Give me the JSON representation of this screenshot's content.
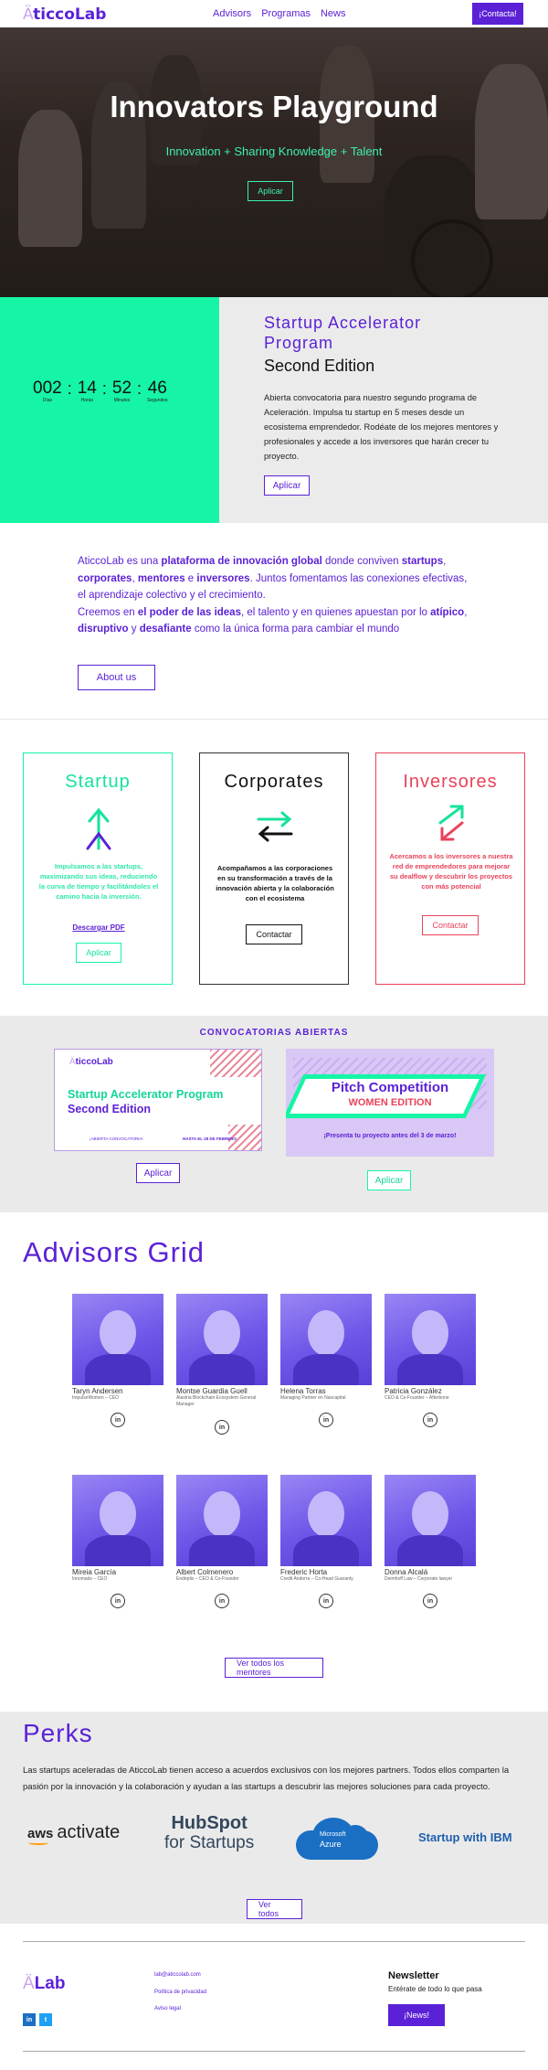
{
  "nav": {
    "logo_a": "Ä",
    "logo_rest": "ticcoLab",
    "links": [
      "Advisors",
      "Programas",
      "News"
    ],
    "contact": "¡Contacta!"
  },
  "hero": {
    "title": "Innovators Playground",
    "subtitle": "Innovation + Sharing Knowledge + Talent",
    "button": "Aplicar"
  },
  "accelerator": {
    "countdown": [
      {
        "value": "002",
        "label": "Días"
      },
      {
        "value": "14",
        "label": "Horas"
      },
      {
        "value": "52",
        "label": "Minutos"
      },
      {
        "value": "46",
        "label": "Segundos"
      }
    ],
    "title": "Startup Accelerator Program",
    "edition": "Second Edition",
    "description": "Abierta convocatoria para nuestro segundo programa de Aceleración. Impulsa tu startup en 5 meses desde un ecosistema emprendedor. Rodéate de los mejores mentores y profesionales y accede a los inversores que harán crecer tu proyecto.",
    "button": "Aplicar"
  },
  "about": {
    "p1_a": "AticcoLab es una ",
    "p1_b": "plataforma de innovación global",
    "p1_c": " donde conviven ",
    "p1_d": "startups",
    "p1_e": ", ",
    "p1_f": "corporates",
    "p1_g": ", ",
    "p1_h": "mentores",
    "p1_i": " e ",
    "p1_j": "inversores",
    "p1_k": ". Juntos fomentamos las conexiones efectivas, el aprendizaje colectivo y el crecimiento.",
    "p2_a": "Creemos en ",
    "p2_b": "el poder de las ideas",
    "p2_c": ", el talento y en quienes apuestan por lo ",
    "p2_d": "atípico",
    "p2_e": ", ",
    "p2_f": "disruptivo",
    "p2_g": " y ",
    "p2_h": "desafiante",
    "p2_i": " como la única forma para cambiar el mundo",
    "button": "About us"
  },
  "cards": {
    "startup": {
      "title": "Startup",
      "text": "Impulsamos a las startups, maximizando sus ideas, reduciendo la curva de tiempo y facilitándoles el camino hacia la inversión.",
      "link": "Descargar PDF",
      "button": "Aplicar"
    },
    "corporates": {
      "title": "Corporates",
      "text": "Acompañamos a las corporaciones en su transformación a través de la innovación abierta y la colaboración con el ecosistema",
      "button": "Contactar"
    },
    "inversores": {
      "title": "Inversores",
      "text": "Acercamos a los inversores a nuestra red de emprendedores para mejorar su dealflow y descubrir los proyectos con más potencial",
      "button": "Contactar"
    }
  },
  "convocatorias": {
    "title": "CONVOCATORIAS ABIERTAS",
    "banner1": {
      "logo_a": "Ä",
      "logo_rest": "ticcoLab",
      "title_a": "Startup Accelerator Program",
      "title_b": "Second Edition",
      "footer_a": "¡ABIERTA CONVOCATORIA!",
      "footer_b": "HASTA EL 28 DE FEBRERO"
    },
    "banner2": {
      "title": "Pitch Competition",
      "subtitle": "WOMEN EDITION",
      "footer": "¡Presenta tu proyecto antes del 3 de marzo!"
    },
    "button1": "Aplicar",
    "button2": "Aplicar"
  },
  "advisors": {
    "title": "Advisors Grid",
    "people": [
      {
        "name": "Taryn Andersen",
        "role": "ImpulseWomen – CEO"
      },
      {
        "name": "Montse Guardia Guell",
        "role": "Alastria Blockchain Ecosystem General Manager"
      },
      {
        "name": "Helena Torras",
        "role": "Managing Partner en Nascapital"
      },
      {
        "name": "Patricia González",
        "role": "CEO & Co-Founder – Afterbone"
      },
      {
        "name": "Mireia García",
        "role": "Innomads – CEO"
      },
      {
        "name": "Albert Colmenero",
        "role": "Endeptis – CEO & Co-Founder"
      },
      {
        "name": "Frederic Horta",
        "role": "Credit Andorra – Co-Head Guaranty"
      },
      {
        "name": "Donna Alcalá",
        "role": "Deimhoff Law – Corporate lawyer"
      }
    ],
    "linkedin": "in",
    "button": "Ver todos los mentores"
  },
  "perks": {
    "title": "Perks",
    "text": "Las startups aceleradas de AticcoLab tienen acceso a acuerdos exclusivos con los mejores partners. Todos ellos comparten la pasión por la innovación y la colaboración y ayudan a las startups a descubrir las mejores soluciones para cada proyecto.",
    "partners": {
      "aws_a": "aws",
      "aws_b": "activate",
      "hubspot_a": "HubSpot",
      "hubspot_b": "for Startups",
      "azure_a": "Microsoft",
      "azure_b": "Azure",
      "ibm": "Startup with IBM"
    },
    "button": "Ver todos"
  },
  "footer": {
    "logo_a": "Ä",
    "logo_rest": "Lab",
    "linkedin": "in",
    "twitter": "t",
    "links": [
      "lab@aticcolab.com",
      "Política de privacidad",
      "Aviso legal"
    ],
    "newsletter_title": "Newsletter",
    "newsletter_text": "Entérate de todo lo que pasa",
    "newsletter_button": "¡News!"
  },
  "colors": {
    "brand": "#5b21d6",
    "green": "#15f5a5",
    "red": "#e8435a"
  }
}
